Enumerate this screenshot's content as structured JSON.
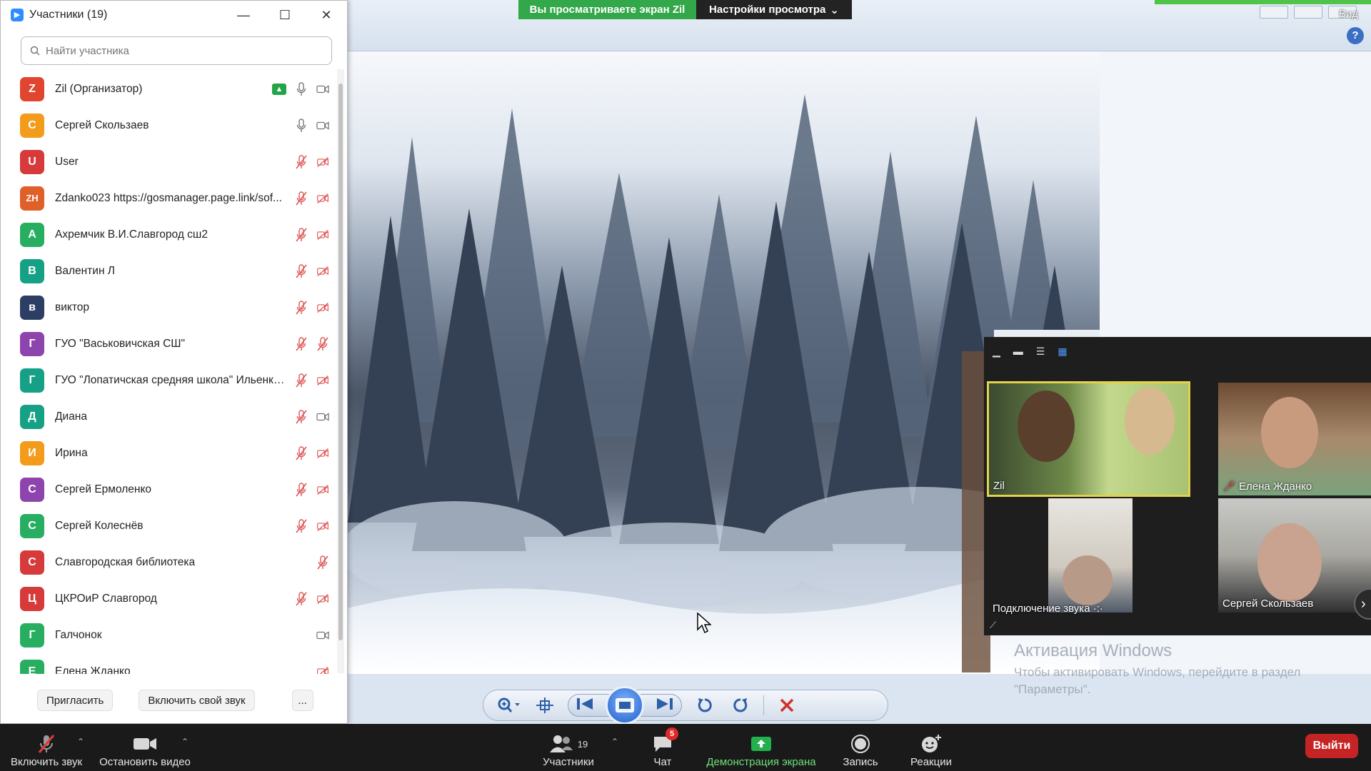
{
  "banner": {
    "viewing_text": "Вы просматриваете экран Zil",
    "view_settings": "Настройки просмотра",
    "view_settings_caret": "⌄",
    "vid_label": "Вид"
  },
  "participants_panel": {
    "title": "Участники (19)",
    "search_placeholder": "Найти участника",
    "participants": [
      {
        "initials": "Z",
        "name": "Zil (Организатор)",
        "color": "#e0452f",
        "mic": "on",
        "video": "on",
        "sharing": true
      },
      {
        "initials": "С",
        "name": "Сергей Скользаев",
        "color": "#f39b1a",
        "mic": "on",
        "video": "on"
      },
      {
        "initials": "U",
        "name": "User",
        "color": "#d63a3a",
        "mic": "off",
        "video": "off"
      },
      {
        "initials": "ZH",
        "name": "Zdanko023 https://gosmanager.page.link/sof...",
        "color": "#e0602a",
        "mic": "off",
        "video": "off"
      },
      {
        "initials": "А",
        "name": "Ахремчик В.И.Славгород сш2",
        "color": "#27ae60",
        "mic": "off",
        "video": "off"
      },
      {
        "initials": "В",
        "name": "Валентин Л",
        "color": "#16a085",
        "mic": "off",
        "video": "off"
      },
      {
        "initials": "в",
        "name": "виктор",
        "color": "#2c3e63",
        "mic": "off",
        "video": "off"
      },
      {
        "initials": "Г",
        "name": "ГУО \"Васьковичская СШ\"",
        "color": "#8e44ad",
        "mic": "off",
        "video": "none"
      },
      {
        "initials": "Г",
        "name": "ГУО \"Лопатичская средняя школа\" Ильенко...",
        "color": "#16a085",
        "mic": "off",
        "video": "off"
      },
      {
        "initials": "Д",
        "name": "Диана",
        "color": "#16a085",
        "mic": "off",
        "video": "on"
      },
      {
        "initials": "И",
        "name": "Ирина",
        "color": "#f39b1a",
        "mic": "off",
        "video": "off"
      },
      {
        "initials": "С",
        "name": "Сергей Ермоленко",
        "color": "#8e44ad",
        "mic": "off",
        "video": "off"
      },
      {
        "initials": "С",
        "name": "Сергей Колеснёв",
        "color": "#27ae60",
        "mic": "off",
        "video": "off"
      },
      {
        "initials": "С",
        "name": "Славгородская библиотека",
        "color": "#d63a3a",
        "mic": "none",
        "video": "off-mic"
      },
      {
        "initials": "Ц",
        "name": "ЦКРОиР Славгород",
        "color": "#d63a3a",
        "mic": "off",
        "video": "off"
      },
      {
        "initials": "Г",
        "name": "Галчонок",
        "color": "#27ae60",
        "mic": "none",
        "video": "on"
      },
      {
        "initials": "Е",
        "name": "Елена Жданко",
        "color": "#27ae60",
        "mic": "none",
        "video": "off"
      }
    ],
    "invite_label": "Пригласить",
    "unmute_self_label": "Включить свой звук",
    "more_label": "..."
  },
  "gallery": {
    "tiles": [
      {
        "name": "Zil"
      },
      {
        "name": "Елена Жданко"
      },
      {
        "name": "Подключение звука"
      },
      {
        "name": "Сергей Скользаев"
      }
    ]
  },
  "watermark": {
    "title": "Активация Windows",
    "subtitle": "Чтобы активировать Windows, перейдите в раздел \"Параметры\"."
  },
  "meeting_bar": {
    "unmute": "Включить звук",
    "stop_video": "Остановить видео",
    "participants": "Участники",
    "participants_count": "19",
    "chat": "Чат",
    "chat_badge": "5",
    "share_screen": "Демонстрация экрана",
    "record": "Запись",
    "reactions": "Реакции",
    "leave": "Выйти"
  }
}
